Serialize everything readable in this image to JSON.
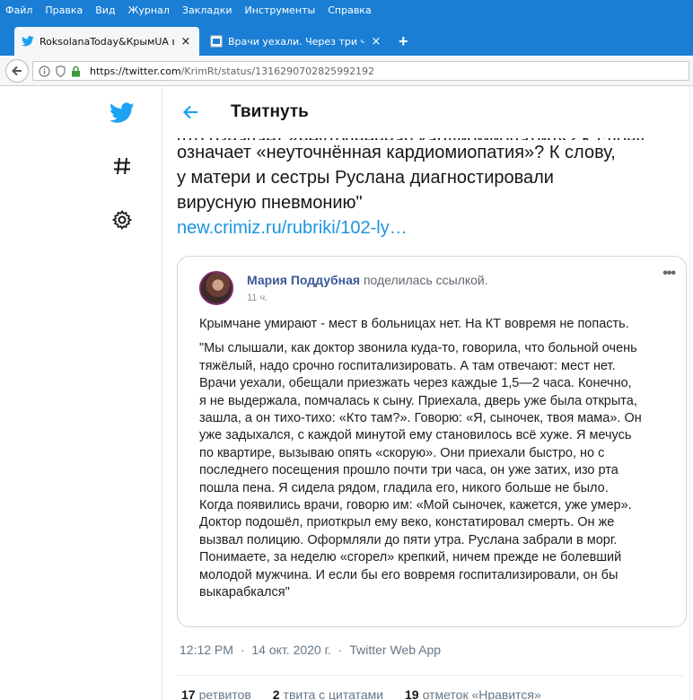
{
  "menu": [
    "Файл",
    "Правка",
    "Вид",
    "Журнал",
    "Закладки",
    "Инструменты",
    "Справка"
  ],
  "tabs": [
    {
      "title": "RoksolanaToday&КрымUA в ...",
      "close": "×"
    },
    {
      "title": "Врачи уехали. Через три ча...",
      "close": "×"
    }
  ],
  "new_tab": "+",
  "url": {
    "host": "https://twitter.com",
    "path": "/KrimRt/status/1316290702825992192"
  },
  "header": {
    "title": "Твитнуть"
  },
  "tweet": {
    "lines": [
      "что означает «неуточнённая кардиомиопатия»? К слову,",
      "означает «неуточнённая кардиомиопатия»? К слову,",
      "у матери и сестры Руслана диагностировали",
      "вирусную пневмонию\""
    ],
    "link": "new.crimiz.ru/rubriki/102-ly…"
  },
  "card": {
    "author": "Мария Поддубная",
    "shared": "поделилась ссылкой.",
    "time": "11 ч.",
    "more": "•••",
    "lead": "Крымчане умирают - мест в больницах нет. На КТ вовремя не попасть.",
    "quote": [
      "\"Мы слышали, как доктор звонила куда-то, говорила, что больной очень",
      "тяжёлый, надо срочно госпитализировать. А там отвечают: мест нет.",
      "Врачи уехали, обещали приезжать через каждые 1,5—2 часа. Конечно,",
      "я не выдержала, помчалась к сыну. Приехала, дверь уже была открыта,",
      "зашла, а он тихо-тихо: «Кто там?». Говорю: «Я, сыночек, твоя мама». Он",
      "уже задыхался, с каждой минутой ему становилось всё хуже. Я мечусь",
      "по квартире, вызываю опять «скорую». Они приехали быстро, но с",
      "последнего посещения прошло почти три часа, он уже затих, изо рта",
      "пошла пена. Я сидела рядом, гладила его, никого больше не было.",
      "Когда появились врачи, говорю им: «Мой сыночек, кажется, уже умер».",
      "Доктор подошёл, приоткрыл ему веко, констатировал смерть. Он же",
      "вызвал полицию. Оформляли до пяти утра. Руслана забрали в морг.",
      "Понимаете, за неделю «сгорел» крепкий, ничем прежде не болевший",
      "молодой мужчина. И если бы его вовремя госпитализировали, он бы",
      "выкарабкался\""
    ]
  },
  "meta": {
    "time": "12:12 PM",
    "sep1": "·",
    "date": "14 окт. 2020 г.",
    "sep2": "·",
    "app": "Twitter Web App"
  },
  "stats": [
    {
      "count": "17",
      "label": "ретвитов"
    },
    {
      "count": "2",
      "label": "твита с цитатами"
    },
    {
      "count": "19",
      "label": "отметок «Нравится»"
    }
  ],
  "colors": {
    "accent": "#1da1f2",
    "link": "#1b95e0",
    "chrome": "#1a7fd4",
    "fb_name": "#3b5998"
  }
}
